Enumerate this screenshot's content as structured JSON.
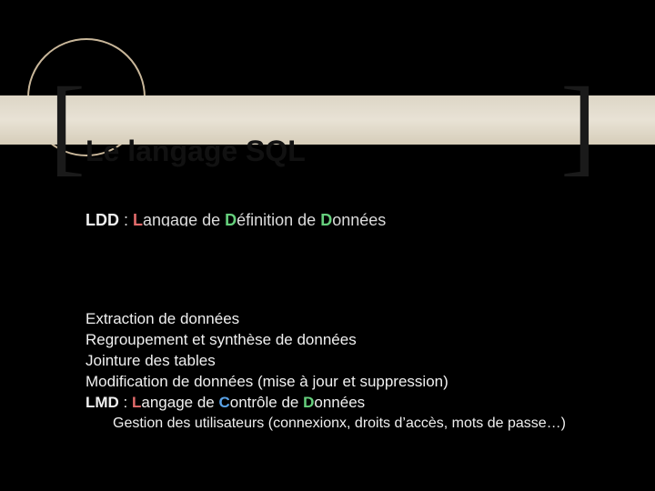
{
  "title": "Le langage SQL",
  "subtitle_ldd": {
    "abbr": "LDD",
    "sep": " : ",
    "l_cap": "L",
    "l_rest": "angage de ",
    "d1_cap": "D",
    "d1_rest": "éfinition de ",
    "d2_cap": "D",
    "d2_rest": "onnées"
  },
  "body": {
    "l1": "Extraction de données",
    "l2": "Regroupement et synthèse de données",
    "l3": "Jointure des tables",
    "l4": "Modification de données (mise à jour et suppression)",
    "ldc": {
      "abbr": "LMD",
      "sep": " : ",
      "l_cap": "L",
      "l_rest": "angage de ",
      "c_cap": "C",
      "c_rest": "ontrôle de ",
      "d_cap": "D",
      "d_rest": "onnées"
    },
    "indent": "Gestion des utilisateurs (connexionx, droits d’accès, mots de passe…)"
  },
  "brackets": {
    "left": "[",
    "right": "]"
  }
}
